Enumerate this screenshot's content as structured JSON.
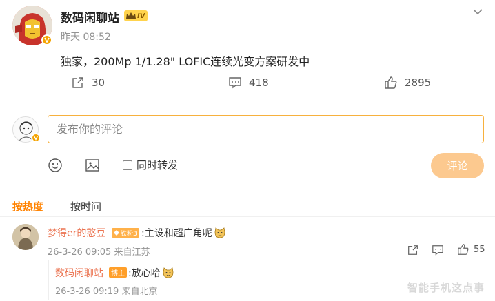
{
  "post": {
    "author": "数码闲聊站",
    "level_badge": "IV",
    "time": "昨天 08:52",
    "text": "独家，200Mp 1/1.28\" LOFIC连续光变方案研发中",
    "actions": [
      {
        "icon": "share-icon",
        "count": "30"
      },
      {
        "icon": "comment-icon",
        "count": "418"
      },
      {
        "icon": "like-icon",
        "count": "2895"
      }
    ]
  },
  "composer": {
    "placeholder": "发布你的评论",
    "repost_label": "同时转发",
    "submit_label": "评论",
    "tools": [
      "emoji-icon",
      "image-icon"
    ]
  },
  "sort": {
    "hot": "按热度",
    "time": "按时间"
  },
  "comment": {
    "author": "梦得er的憨豆",
    "fan_badge": "铁粉3",
    "text": ":主设和超广角呢",
    "emoji": "doge-emoji",
    "time": "26-3-26 09:05 来自江苏",
    "likes": "55",
    "reply": {
      "author": "数码闲聊站",
      "badge": "博主",
      "text": ":放心哈",
      "emoji": "doge-emoji",
      "time": "26-3-26 09:19 来自北京"
    }
  },
  "watermark": "智能手机这点事",
  "colors": {
    "accent": "#ff8200",
    "input_border": "#f7b13e",
    "submit_disabled": "#fcc98f",
    "username": "#eb7350"
  }
}
